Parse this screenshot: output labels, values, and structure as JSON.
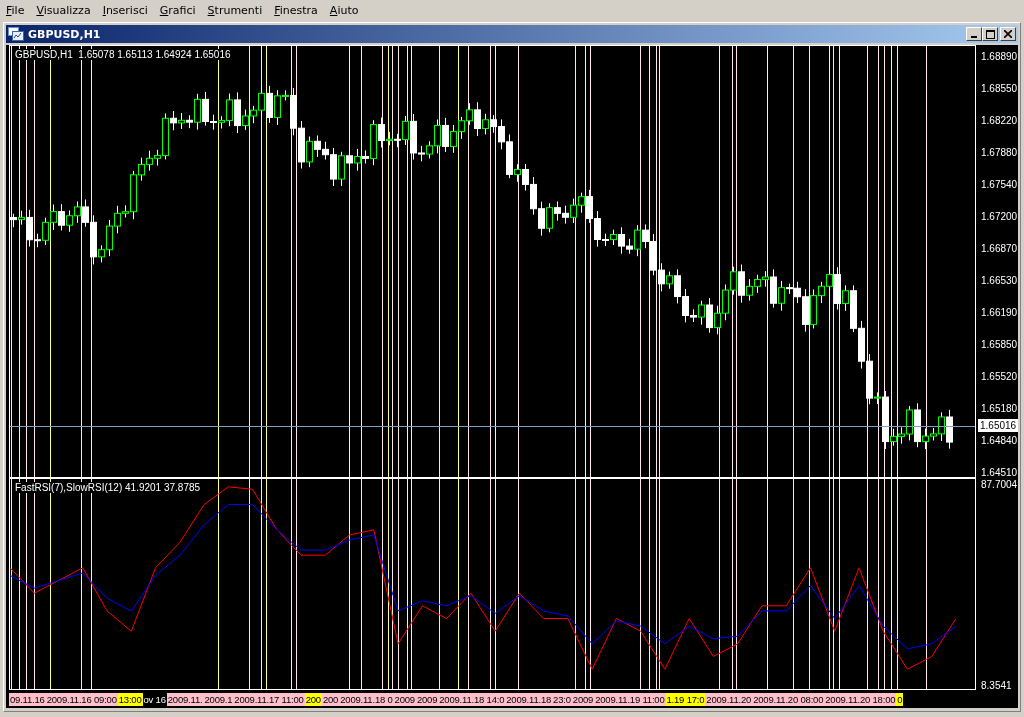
{
  "menu": [
    "File",
    "Visualizza",
    "Inserisci",
    "Grafici",
    "Strumenti",
    "Finestra",
    "Aiuto"
  ],
  "window": {
    "title": "GBPUSD,H1"
  },
  "chart": {
    "header": "GBPUSD,H1  1.65078 1.65113 1.64924 1.65016",
    "price_axis": [
      "1.68890",
      "1.68550",
      "1.68220",
      "1.67880",
      "1.67540",
      "1.67200",
      "1.66870",
      "1.66530",
      "1.66190",
      "1.65850",
      "1.65520",
      "1.65180",
      "1.64840",
      "1.64510"
    ],
    "current_price": "1.65016"
  },
  "indicator": {
    "label": "FastRSI(7),SlowRSI(12) 41.9201 37.8785",
    "scale_labels": [
      "87.7004",
      "8.3541"
    ]
  },
  "time_axis": [
    {
      "text": "09.11.16",
      "color": "#ffc0cb"
    },
    {
      "text": "2009.11.16 09:00",
      "color": "#ffc0cb"
    },
    {
      "text": "13:00",
      "color": "#ffff00"
    },
    {
      "text": "ov 16",
      "color": "#000000"
    },
    {
      "text": "2009.11.",
      "color": "#ffc0cb"
    },
    {
      "text": "2009.1",
      "color": "#ffc0cb"
    },
    {
      "text": "2009.11.17 11:00",
      "color": "#ffc0cb"
    },
    {
      "text": "200",
      "color": "#ffff00"
    },
    {
      "text": "200",
      "color": "#ffc0cb"
    },
    {
      "text": "2009.11.18 0",
      "color": "#ffc0cb"
    },
    {
      "text": "2009",
      "color": "#ffc0cb"
    },
    {
      "text": "2009",
      "color": "#ffc0cb"
    },
    {
      "text": "2009.11.18 14:0",
      "color": "#ffc0cb"
    },
    {
      "text": "2009.11.18",
      "color": "#ffc0cb"
    },
    {
      "text": "23:0",
      "color": "#ffc0cb"
    },
    {
      "text": "2009",
      "color": "#ffc0cb"
    },
    {
      "text": "2009.11.19 11:00",
      "color": "#ffc0cb"
    },
    {
      "text": "1.19 17:0",
      "color": "#ffff00"
    },
    {
      "text": "2009.11.20",
      "color": "#ffc0cb"
    },
    {
      "text": "2009.11.20 08:00",
      "color": "#ffc0cb"
    },
    {
      "text": "2009.11.20 18:00",
      "color": "#ffc0cb"
    },
    {
      "text": "0",
      "color": "#ffff00"
    }
  ]
}
